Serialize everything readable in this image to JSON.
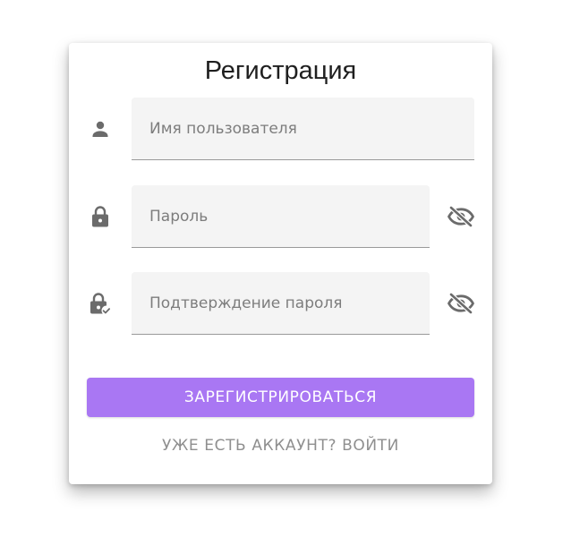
{
  "form": {
    "title": "Регистрация",
    "username": {
      "placeholder": "Имя пользователя",
      "value": "",
      "icon": "person-icon"
    },
    "password": {
      "placeholder": "Пароль",
      "value": "",
      "icon": "lock-icon",
      "toggle_icon": "eye-off-icon"
    },
    "confirm_password": {
      "placeholder": "Подтверждение пароля",
      "value": "",
      "icon": "lock-check-icon",
      "toggle_icon": "eye-off-icon"
    },
    "submit_label": "ЗАРЕГИСТРИРОВАТЬСЯ",
    "login_link_label": "УЖЕ ЕСТЬ АККАУНТ? ВОЙТИ"
  },
  "colors": {
    "accent": "#a977f3",
    "icon": "#6b6b6b",
    "link": "#8f8f8f"
  }
}
